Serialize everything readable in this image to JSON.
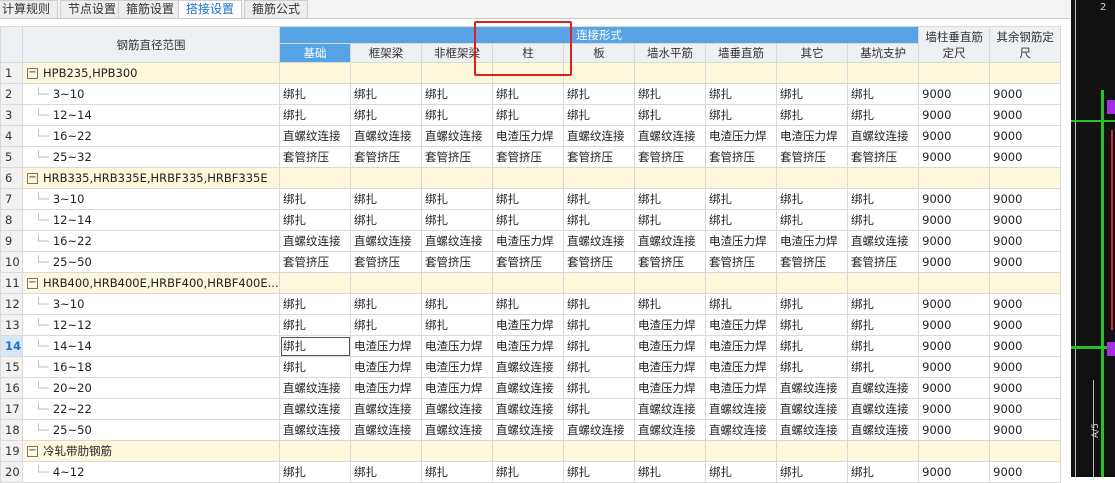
{
  "tabs": [
    "计算规则",
    "节点设置",
    "箍筋设置",
    "搭接设置",
    "箍筋公式"
  ],
  "active_tab": 3,
  "header": {
    "range_label": "钢筋直径范围",
    "group_label": "连接形式",
    "columns": [
      "基础",
      "框架梁",
      "非框架梁",
      "柱",
      "板",
      "墙水平筋",
      "墙垂直筋",
      "其它",
      "基坑支护"
    ],
    "wall_vertical_label": "墙柱垂直筋定尺",
    "other_label": "其余钢筋定尺"
  },
  "rows": [
    {
      "n": "1",
      "group": true,
      "label": "HPB235,HPB300"
    },
    {
      "n": "2",
      "label": "3~10",
      "cells": [
        "绑扎",
        "绑扎",
        "绑扎",
        "绑扎",
        "绑扎",
        "绑扎",
        "绑扎",
        "绑扎",
        "绑扎"
      ],
      "v1": "9000",
      "v2": "9000"
    },
    {
      "n": "3",
      "label": "12~14",
      "cells": [
        "绑扎",
        "绑扎",
        "绑扎",
        "绑扎",
        "绑扎",
        "绑扎",
        "绑扎",
        "绑扎",
        "绑扎"
      ],
      "v1": "9000",
      "v2": "9000"
    },
    {
      "n": "4",
      "label": "16~22",
      "cells": [
        "直螺纹连接",
        "直螺纹连接",
        "直螺纹连接",
        "电渣压力焊",
        "直螺纹连接",
        "直螺纹连接",
        "电渣压力焊",
        "电渣压力焊",
        "直螺纹连接"
      ],
      "v1": "9000",
      "v2": "9000"
    },
    {
      "n": "5",
      "label": "25~32",
      "cells": [
        "套管挤压",
        "套管挤压",
        "套管挤压",
        "套管挤压",
        "套管挤压",
        "套管挤压",
        "套管挤压",
        "套管挤压",
        "套管挤压"
      ],
      "v1": "9000",
      "v2": "9000"
    },
    {
      "n": "6",
      "group": true,
      "label": "HRB335,HRB335E,HRBF335,HRBF335E"
    },
    {
      "n": "7",
      "label": "3~10",
      "cells": [
        "绑扎",
        "绑扎",
        "绑扎",
        "绑扎",
        "绑扎",
        "绑扎",
        "绑扎",
        "绑扎",
        "绑扎"
      ],
      "v1": "9000",
      "v2": "9000"
    },
    {
      "n": "8",
      "label": "12~14",
      "cells": [
        "绑扎",
        "绑扎",
        "绑扎",
        "绑扎",
        "绑扎",
        "绑扎",
        "绑扎",
        "绑扎",
        "绑扎"
      ],
      "v1": "9000",
      "v2": "9000"
    },
    {
      "n": "9",
      "label": "16~22",
      "cells": [
        "直螺纹连接",
        "直螺纹连接",
        "直螺纹连接",
        "电渣压力焊",
        "直螺纹连接",
        "直螺纹连接",
        "电渣压力焊",
        "电渣压力焊",
        "直螺纹连接"
      ],
      "v1": "9000",
      "v2": "9000"
    },
    {
      "n": "10",
      "label": "25~50",
      "cells": [
        "套管挤压",
        "套管挤压",
        "套管挤压",
        "套管挤压",
        "套管挤压",
        "套管挤压",
        "套管挤压",
        "套管挤压",
        "套管挤压"
      ],
      "v1": "9000",
      "v2": "9000"
    },
    {
      "n": "11",
      "group": true,
      "label": "HRB400,HRB400E,HRBF400,HRBF400E..."
    },
    {
      "n": "12",
      "label": "3~10",
      "cells": [
        "绑扎",
        "绑扎",
        "绑扎",
        "绑扎",
        "绑扎",
        "绑扎",
        "绑扎",
        "绑扎",
        "绑扎"
      ],
      "v1": "9000",
      "v2": "9000"
    },
    {
      "n": "13",
      "label": "12~12",
      "cells": [
        "绑扎",
        "绑扎",
        "绑扎",
        "电渣压力焊",
        "绑扎",
        "电渣压力焊",
        "电渣压力焊",
        "绑扎",
        "绑扎"
      ],
      "v1": "9000",
      "v2": "9000"
    },
    {
      "n": "14",
      "label": "14~14",
      "selected": true,
      "cells": [
        "绑扎",
        "电渣压力焊",
        "电渣压力焊",
        "电渣压力焊",
        "绑扎",
        "电渣压力焊",
        "电渣压力焊",
        "绑扎",
        "绑扎"
      ],
      "v1": "9000",
      "v2": "9000"
    },
    {
      "n": "15",
      "label": "16~18",
      "cells": [
        "绑扎",
        "电渣压力焊",
        "电渣压力焊",
        "直螺纹连接",
        "绑扎",
        "电渣压力焊",
        "电渣压力焊",
        "绑扎",
        "绑扎"
      ],
      "v1": "9000",
      "v2": "9000"
    },
    {
      "n": "16",
      "label": "20~20",
      "cells": [
        "直螺纹连接",
        "电渣压力焊",
        "电渣压力焊",
        "直螺纹连接",
        "绑扎",
        "电渣压力焊",
        "电渣压力焊",
        "直螺纹连接",
        "直螺纹连接"
      ],
      "v1": "9000",
      "v2": "9000"
    },
    {
      "n": "17",
      "label": "22~22",
      "cells": [
        "直螺纹连接",
        "直螺纹连接",
        "直螺纹连接",
        "直螺纹连接",
        "绑扎",
        "直螺纹连接",
        "直螺纹连接",
        "直螺纹连接",
        "直螺纹连接"
      ],
      "v1": "9000",
      "v2": "9000"
    },
    {
      "n": "18",
      "label": "25~50",
      "cells": [
        "直螺纹连接",
        "直螺纹连接",
        "直螺纹连接",
        "直螺纹连接",
        "直螺纹连接",
        "直螺纹连接",
        "直螺纹连接",
        "直螺纹连接",
        "直螺纹连接"
      ],
      "v1": "9000",
      "v2": "9000"
    },
    {
      "n": "19",
      "group": true,
      "label": "冷轧带肋钢筋"
    },
    {
      "n": "20",
      "label": "4~12",
      "cells": [
        "绑扎",
        "绑扎",
        "绑扎",
        "绑扎",
        "绑扎",
        "绑扎",
        "绑扎",
        "绑扎",
        "绑扎"
      ],
      "v1": "9000",
      "v2": "9000"
    }
  ],
  "drawing": {
    "top_label": "2",
    "side_label": "A/5"
  },
  "colors": {
    "header_blue": "#56a3e5",
    "group_row": "#fdf7dc",
    "highlight": "#e02020",
    "selected_row": "#1a73c9"
  }
}
